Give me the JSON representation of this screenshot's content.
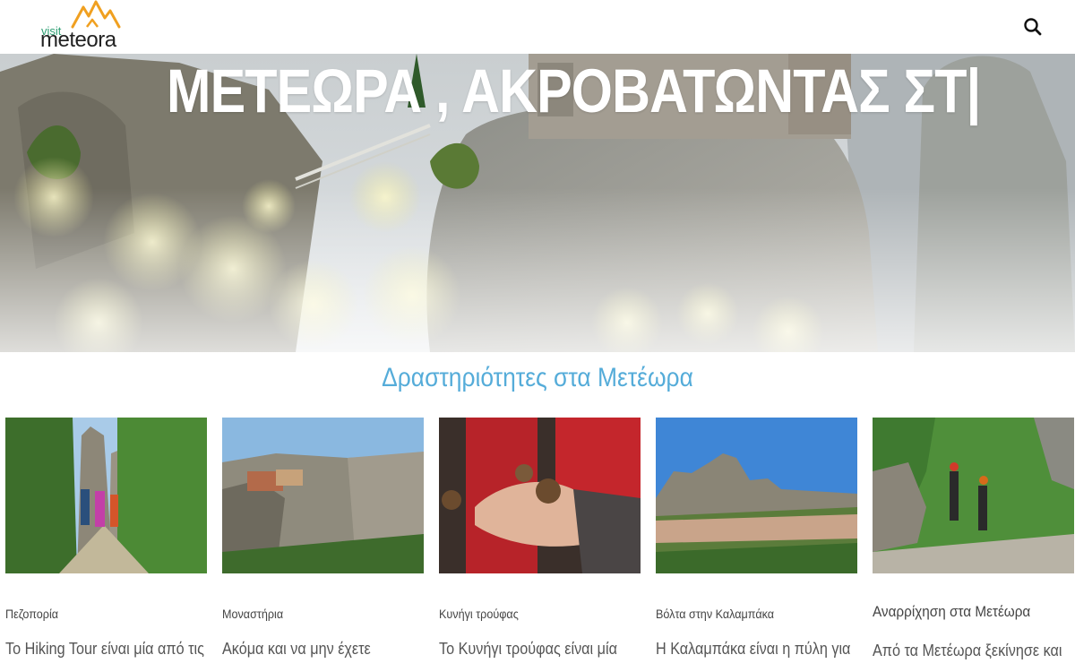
{
  "header": {
    "logo": {
      "small": "visit",
      "main": "meteora"
    },
    "search_icon": "search-icon"
  },
  "hero": {
    "title": "ΜΕΤΕΩΡΑ , ΑΚΡΟΒΑΤΩΝΤΑΣ ΣΤ|"
  },
  "section": {
    "title": "Δραστηριότητες στα Μετέωρα"
  },
  "cards": [
    {
      "category": "Πεζοπορία",
      "text": "Το Hiking Tour είναι μία από τις",
      "image": "hikers on forest trail"
    },
    {
      "category": "Μοναστήρια",
      "text": "Ακόμα και να μην έχετε",
      "image": "monastery on rock"
    },
    {
      "category": "Κυνήγι τρούφας",
      "text": "Το Κυνήγι τρούφας είναι μία",
      "image": "truffles in hand"
    },
    {
      "category": "Βόλτα στην Καλαμπάκα",
      "text": "Η Καλαμπάκα είναι η πύλη για",
      "image": "Kalambaka town below rocks"
    },
    {
      "category": "Αναρρίχηση στα Μετέωρα",
      "text": "Από τα Μετέωρα ξεκίνησε και",
      "image": "climbers with helmets"
    }
  ],
  "colors": {
    "accent": "#55acd9",
    "logo_green": "#2e9e73",
    "logo_orange": "#f0a020"
  }
}
